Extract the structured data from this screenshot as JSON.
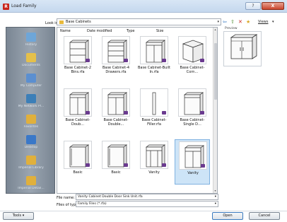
{
  "window": {
    "title": "Load Family",
    "help_label": "?",
    "close_label": "X"
  },
  "lookin": {
    "label": "Look in:",
    "value": "Base Cabinets",
    "arrow": "▾"
  },
  "toolbar": {
    "back": "⇦",
    "up": "⇧",
    "delete": "✕",
    "new_folder": "★",
    "views": "Views",
    "views_arrow": "▾"
  },
  "preview": {
    "label": "Preview"
  },
  "places": [
    {
      "label": "History",
      "icon": "history-icon",
      "color": "#6ea6d8"
    },
    {
      "label": "Documents",
      "icon": "documents-icon",
      "color": "#e5c04a"
    },
    {
      "label": "My Computer",
      "icon": "computer-icon",
      "color": "#5b8fd0"
    },
    {
      "label": "My Network Pl...",
      "icon": "network-icon",
      "color": "#3c7fb8"
    },
    {
      "label": "Favorites",
      "icon": "favorites-folder-icon",
      "color": "#e0b03c"
    },
    {
      "label": "Desktop",
      "icon": "desktop-icon",
      "color": "#3a78c8"
    },
    {
      "label": "Imperial Library",
      "icon": "library-folder-icon",
      "color": "#e0b03c"
    },
    {
      "label": "Imperial Detail...",
      "icon": "detail-folder-icon",
      "color": "#e0b03c"
    }
  ],
  "columns": {
    "name": "Name",
    "date_modified": "Date modified",
    "type": "Type",
    "size": "Size"
  },
  "files": [
    {
      "label": "Base Cabinet-2 Bins.rfa",
      "kind": "bins"
    },
    {
      "label": "Base Cabinet-4 Drawers.rfa",
      "kind": "drawers"
    },
    {
      "label": "Base Cabinet-Built In.rfa",
      "kind": "builtin"
    },
    {
      "label": "Base Cabinet-Corn...",
      "kind": "corner"
    },
    {
      "label": "Base Cabinet-Doub...",
      "kind": "double"
    },
    {
      "label": "Base Cabinet-Double...",
      "kind": "double2"
    },
    {
      "label": "Base Cabinet-Filler.rfa",
      "kind": "filler"
    },
    {
      "label": "Base Cabinet-Single D...",
      "kind": "single"
    },
    {
      "label": "Basic",
      "kind": "basic1"
    },
    {
      "label": "Basic",
      "kind": "basic2"
    },
    {
      "label": "Vanity",
      "kind": "vanity1"
    },
    {
      "label": "Vanity",
      "kind": "vanity2"
    }
  ],
  "selected_index": 11,
  "filename": {
    "label": "File name:",
    "value": "Vanity Cabinet Double Door Sink Unit.rfa",
    "arrow": "▾"
  },
  "filetype": {
    "label": "Files of type:",
    "value": "Family Files (*.rfa)",
    "arrow": "▾"
  },
  "buttons": {
    "tools": "Tools",
    "tools_arrow": "▾",
    "open": "Open",
    "cancel": "Cancel"
  },
  "colors": {
    "accent": "#3b7bbf",
    "selection": "#cde4f7",
    "badge": "#6a3a8f"
  }
}
